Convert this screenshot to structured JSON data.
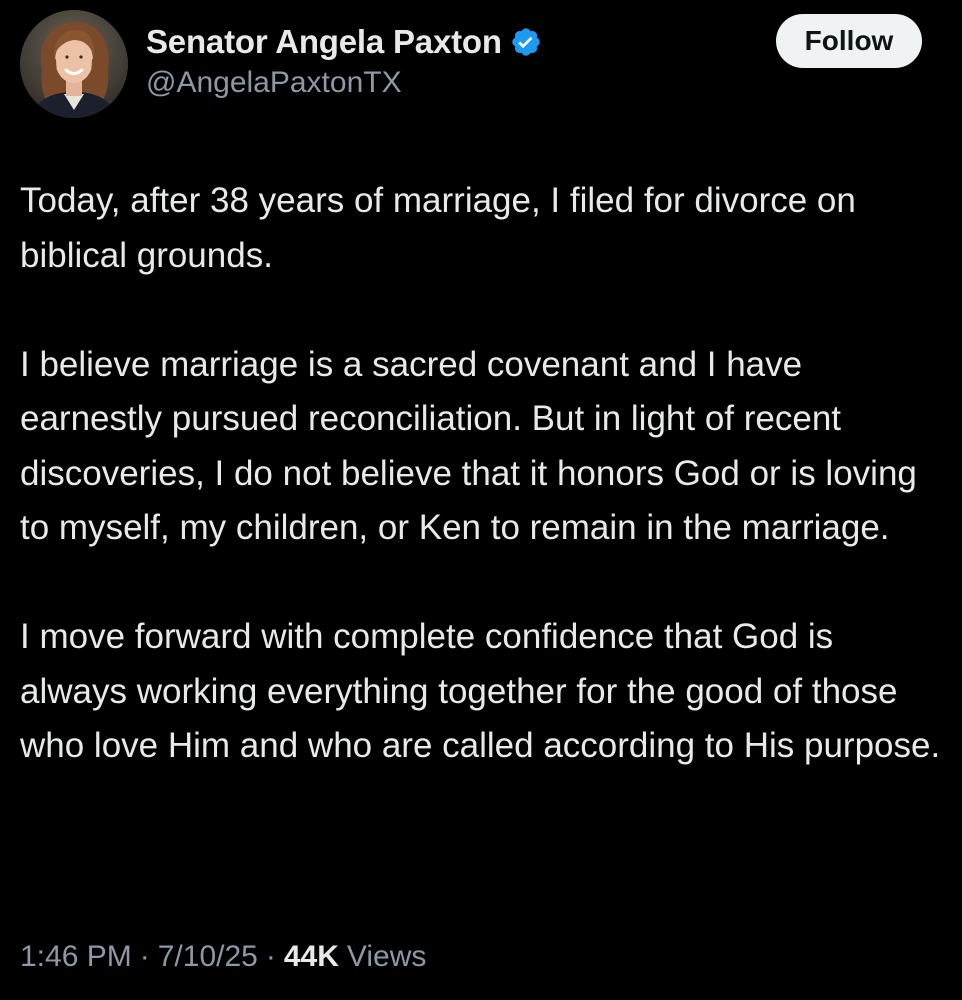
{
  "author": {
    "display_name": "Senator Angela Paxton",
    "handle": "@AngelaPaxtonTX",
    "verified": true,
    "avatar_icon": "profile-photo"
  },
  "follow_button": {
    "label": "Follow"
  },
  "tweet": {
    "paragraphs": [
      "Today, after 38 years of marriage, I filed for divorce on biblical grounds.",
      "I believe marriage is a sacred covenant and I have earnestly pursued reconciliation. But in light of recent discoveries, I do not believe that it honors God or is loving to myself, my children, or Ken to remain in the marriage.",
      "I move forward with complete confidence that God is always working everything together for the good of those who love Him and who are called according to His purpose."
    ]
  },
  "meta": {
    "time": "1:46 PM",
    "separator": "·",
    "date": "7/10/25",
    "views_count": "44K",
    "views_label": "Views"
  },
  "colors": {
    "background": "#000000",
    "text_primary": "#e7e9ea",
    "text_secondary": "#8b98a5",
    "verified_blue": "#1d9bf0",
    "follow_bg": "#eff3f4"
  }
}
